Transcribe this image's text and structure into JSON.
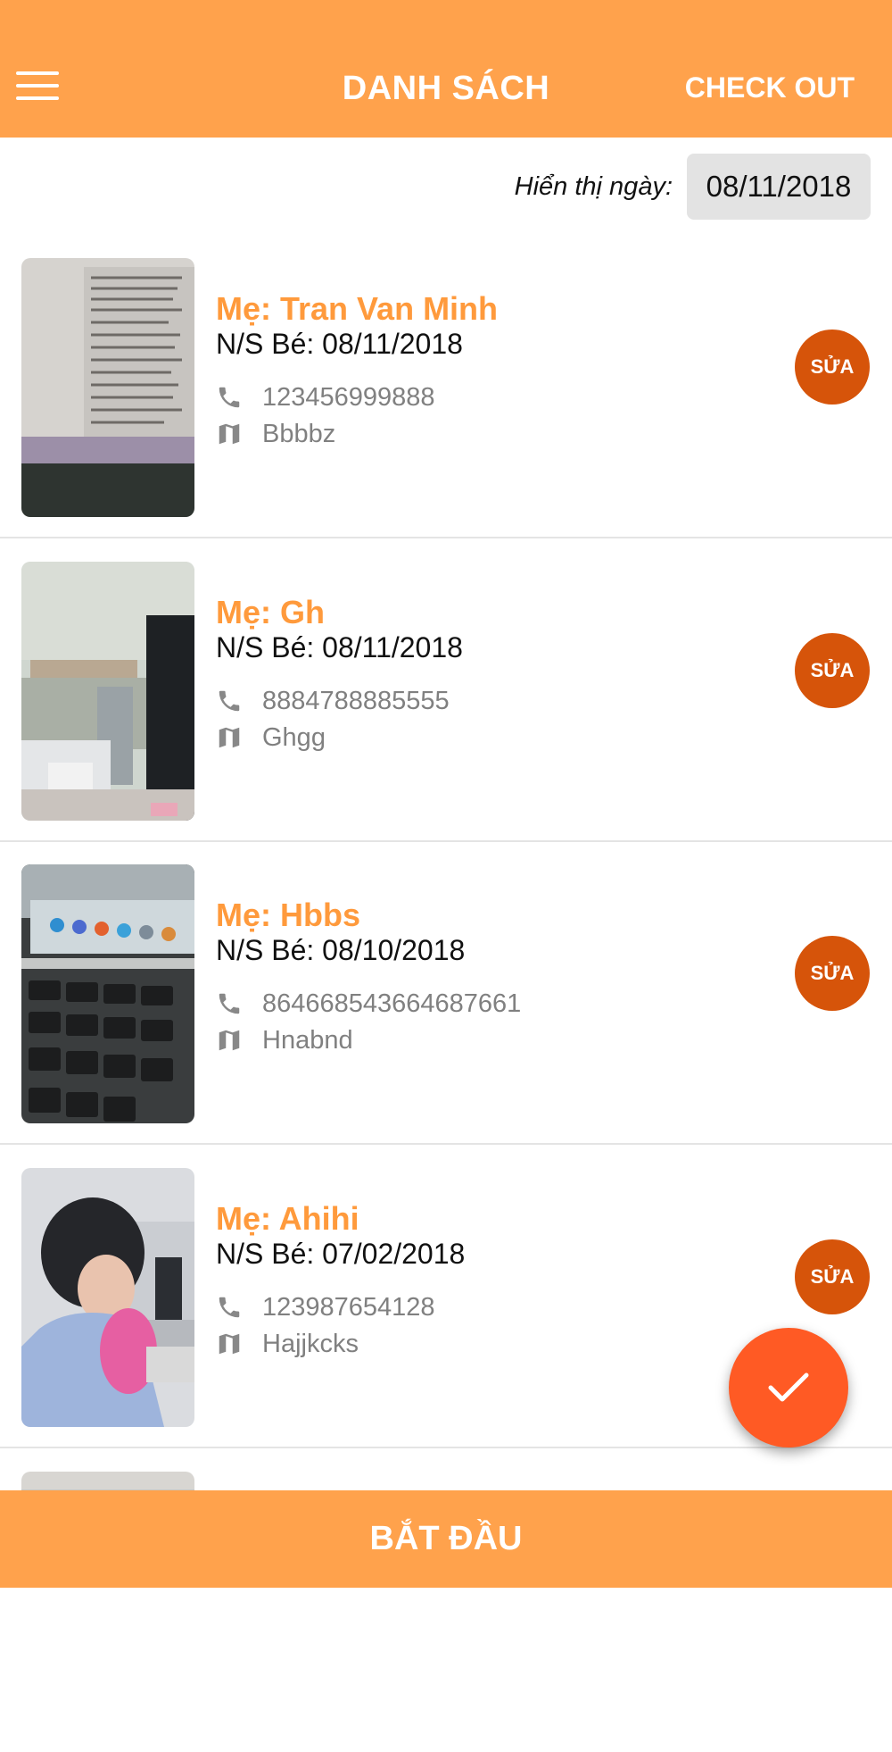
{
  "header": {
    "title": "DANH SÁCH",
    "checkout_label": "CHECK OUT",
    "menu_icon": "menu-icon"
  },
  "date_filter": {
    "label": "Hiển thị ngày:",
    "value": "08/11/2018"
  },
  "list": {
    "items": [
      {
        "mother": "Mẹ: Tran Van Minh",
        "birth": "N/S Bé: 08/11/2018",
        "phone": "123456999888",
        "address": "Bbbbz",
        "edit_label": "SỬA"
      },
      {
        "mother": "Mẹ: Gh",
        "birth": "N/S Bé: 08/11/2018",
        "phone": "8884788885555",
        "address": "Ghgg",
        "edit_label": "SỬA"
      },
      {
        "mother": "Mẹ: Hbbs",
        "birth": "N/S Bé: 08/10/2018",
        "phone": "864668543664687661",
        "address": "Hnabnd",
        "edit_label": "SỬA"
      },
      {
        "mother": "Mẹ: Ahihi",
        "birth": "N/S Bé: 07/02/2018",
        "phone": "123987654128",
        "address": "Hajjkcks",
        "edit_label": "SỬA"
      }
    ]
  },
  "fab": {
    "icon": "check-icon"
  },
  "bottom_bar": {
    "label": "BẮT ĐẦU"
  },
  "colors": {
    "primary": "#FFA24C",
    "accent_text": "#FF9A3C",
    "edit_button": "#D6540A",
    "fab": "#FF5A24"
  }
}
